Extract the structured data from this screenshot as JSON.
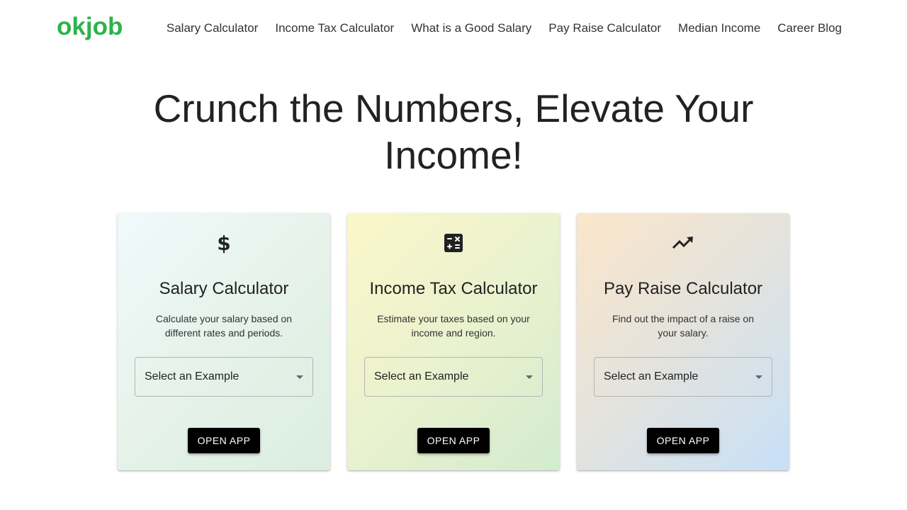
{
  "logo": "okjob",
  "nav": {
    "items": [
      "Salary Calculator",
      "Income Tax Calculator",
      "What is a Good Salary",
      "Pay Raise Calculator",
      "Median Income",
      "Career Blog"
    ]
  },
  "hero": {
    "line1": "Crunch the Numbers, Elevate Your",
    "line2": "Income!"
  },
  "cards": [
    {
      "icon": "dollar-icon",
      "title": "Salary Calculator",
      "description": "Calculate your salary based on different rates and periods.",
      "select_placeholder": "Select an Example",
      "button_label": "OPEN APP"
    },
    {
      "icon": "calculator-icon",
      "title": "Income Tax Calculator",
      "description": "Estimate your taxes based on your income and region.",
      "select_placeholder": "Select an Example",
      "button_label": "OPEN APP"
    },
    {
      "icon": "trending-up-icon",
      "title": "Pay Raise Calculator",
      "description": "Find out the impact of a raise on your salary.",
      "select_placeholder": "Select an Example",
      "button_label": "OPEN APP"
    }
  ],
  "colors": {
    "brand": "#2db34a",
    "button": "#000000"
  }
}
